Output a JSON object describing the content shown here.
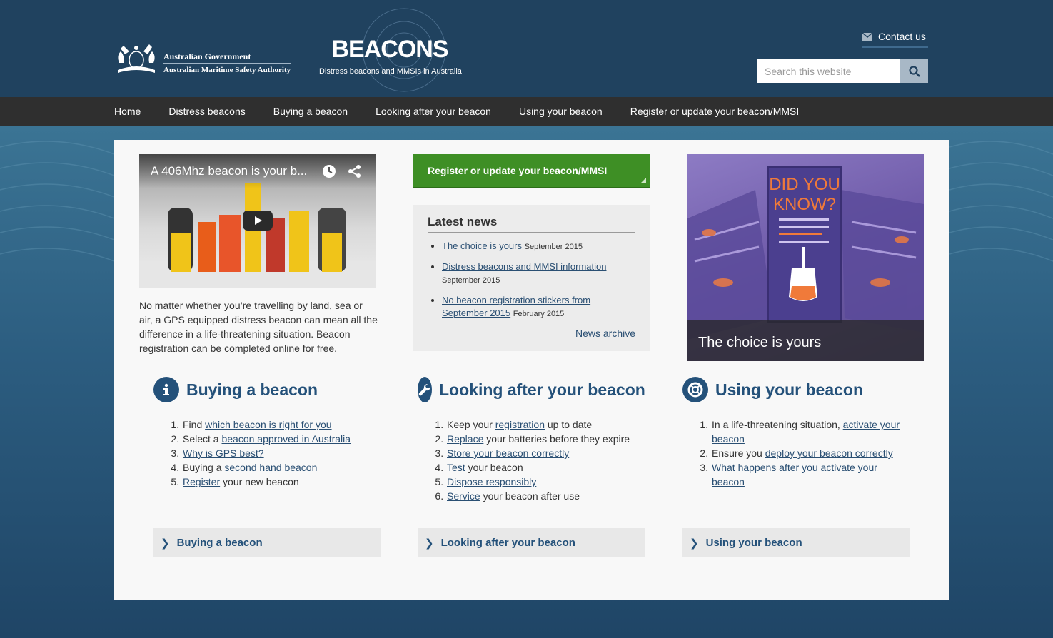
{
  "header": {
    "gov_line1": "Australian Government",
    "gov_line2": "Australian Maritime Safety Authority",
    "site_title": "BEACONS",
    "site_subtitle": "Distress beacons and MMSIs in Australia",
    "contact_label": "Contact us",
    "search_placeholder": "Search this website"
  },
  "nav": {
    "items": [
      {
        "label": "Home"
      },
      {
        "label": "Distress beacons"
      },
      {
        "label": "Buying a beacon"
      },
      {
        "label": "Looking after your beacon"
      },
      {
        "label": "Using your beacon"
      },
      {
        "label": "Register or update your beacon/MMSI"
      }
    ]
  },
  "video": {
    "title": "A 406Mhz beacon is your b..."
  },
  "intro_text": "No matter whether you’re travelling by land, sea or air, a GPS equipped distress beacon can mean all the difference in a life-threatening situation. Beacon registration can be completed online for free.",
  "register_button": "Register or update your beacon/MMSI",
  "news": {
    "heading": "Latest news",
    "items": [
      {
        "link": "The choice is yours",
        "date": "September 2015"
      },
      {
        "link": "Distress beacons and MMSI information",
        "date": "September 2015"
      },
      {
        "link": "No beacon registration stickers from September 2015",
        "date": "February 2015"
      }
    ],
    "archive": "News archive"
  },
  "promo": {
    "caption": "The choice is yours",
    "poster_line1": "DID YOU",
    "poster_line2": "KNOW?"
  },
  "sections": {
    "buying": {
      "title": "Buying a beacon",
      "footer": "Buying a beacon",
      "items": [
        {
          "pre": "Find ",
          "link": "which beacon is right for you",
          "post": ""
        },
        {
          "pre": "Select a ",
          "link": "beacon approved in Australia",
          "post": ""
        },
        {
          "pre": "",
          "link": "Why is GPS best?",
          "post": ""
        },
        {
          "pre": "Buying a ",
          "link": "second hand beacon",
          "post": ""
        },
        {
          "pre": "",
          "link": "Register",
          "post": " your new beacon"
        }
      ]
    },
    "looking": {
      "title": "Looking after your beacon",
      "footer": "Looking after your beacon",
      "items": [
        {
          "pre": "Keep your ",
          "link": "registration",
          "post": " up to date"
        },
        {
          "pre": "",
          "link": "Replace",
          "post": " your batteries before they expire"
        },
        {
          "pre": "",
          "link": "Store your beacon correctly",
          "post": ""
        },
        {
          "pre": "",
          "link": "Test",
          "post": " your beacon"
        },
        {
          "pre": "",
          "link": "Dispose responsibly",
          "post": ""
        },
        {
          "pre": "",
          "link": "Service",
          "post": " your beacon after use"
        }
      ]
    },
    "using": {
      "title": "Using your beacon",
      "footer": "Using your beacon",
      "items": [
        {
          "pre": "In a life-threatening situation, ",
          "link": "activate your beacon",
          "post": ""
        },
        {
          "pre": "Ensure you ",
          "link": "deploy your beacon correctly",
          "post": ""
        },
        {
          "pre": "",
          "link": "What happens after you activate your beacon",
          "post": ""
        }
      ]
    }
  },
  "colors": {
    "header_bg": "#20425f",
    "nav_bg": "#2f2f2f",
    "register_green": "#3e8f25",
    "link_blue": "#2a4f73",
    "section_blue": "#24517a"
  }
}
